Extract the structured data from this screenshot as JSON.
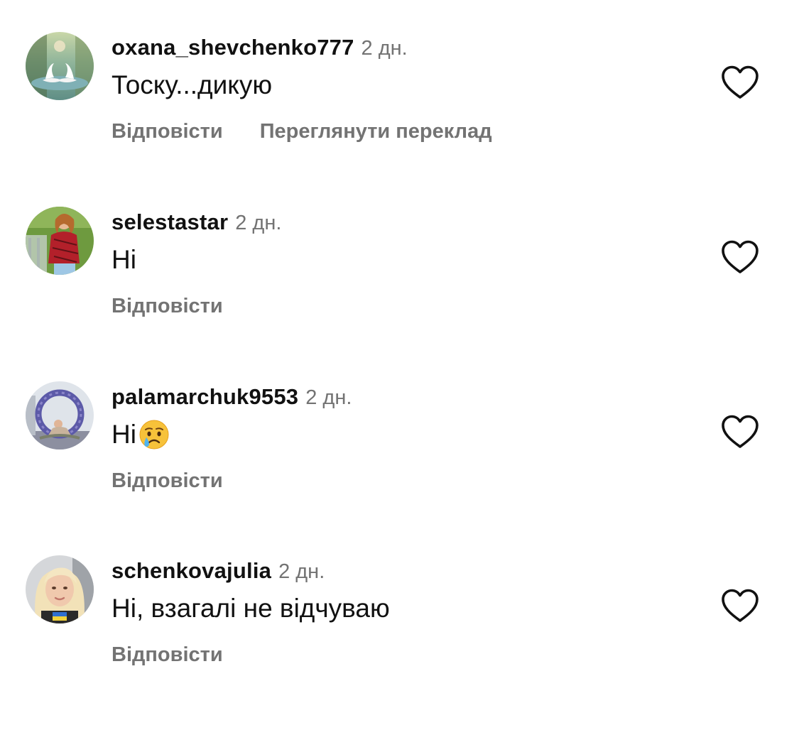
{
  "comments": [
    {
      "username": "oxana_shevchenko777",
      "time": "2 дн.",
      "text": "Тоску...дикую",
      "emoji": "",
      "reply_label": "Відповісти",
      "translate_label": "Переглянути переклад",
      "avatar_icon": "swans-photo-avatar"
    },
    {
      "username": "selestastar",
      "time": "2 дн.",
      "text": "Ні",
      "emoji": "",
      "reply_label": "Відповісти",
      "avatar_icon": "woman-park-photo-avatar"
    },
    {
      "username": "palamarchuk9553",
      "time": "2 дн.",
      "text": "Ні",
      "emoji": "crying-face-icon",
      "reply_label": "Відповісти",
      "avatar_icon": "flower-arch-photo-avatar"
    },
    {
      "username": "schenkovajulia",
      "time": "2 дн.",
      "text": "Ні, взагалі не відчуваю",
      "emoji": "",
      "reply_label": "Відповісти",
      "avatar_icon": "blonde-woman-photo-avatar"
    }
  ],
  "colors": {
    "text_primary": "#111111",
    "text_secondary": "#737373",
    "heart_stroke": "#111111"
  },
  "icons": {
    "like": "heart-outline-icon"
  }
}
